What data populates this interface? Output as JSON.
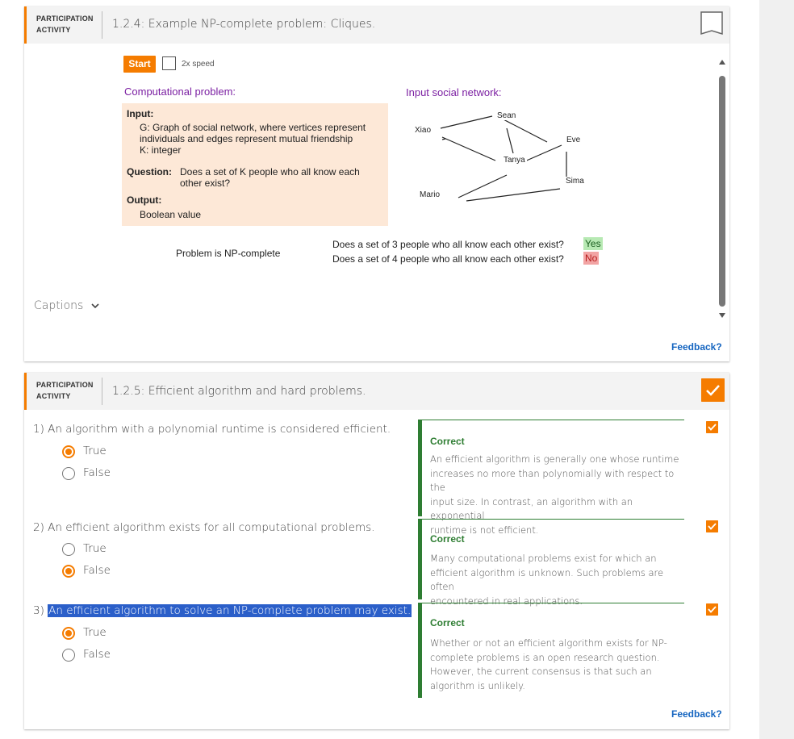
{
  "activity1": {
    "label_line1": "PARTICIPATION",
    "label_line2": "ACTIVITY",
    "title": "1.2.4: Example NP-complete problem: Cliques.",
    "start_label": "Start",
    "speed_label": "2x speed",
    "computational_problem_title": "Computational problem:",
    "input_network_title": "Input social network:",
    "problem": {
      "input_label": "Input:",
      "input_lines": [
        "G: Graph of social network, where vertices represent",
        "individuals and edges represent mutual friendship",
        "K: integer"
      ],
      "question_label": "Question:",
      "question_lines": [
        "Does a set of K people who all know each",
        "other exist?"
      ],
      "output_label": "Output:",
      "output_value": "Boolean value"
    },
    "graph": {
      "nodes": [
        "Sean",
        "Xiao",
        "Eve",
        "Tanya",
        "Sima",
        "Mario"
      ]
    },
    "np_complete_text": "Problem is NP-complete",
    "queries": [
      {
        "text": "Does a set of 3 people who all know each other exist?",
        "answer": "Yes"
      },
      {
        "text": "Does a set of 4 people who all know each other exist?",
        "answer": "No"
      }
    ],
    "captions_label": "Captions",
    "feedback_label": "Feedback?"
  },
  "activity2": {
    "label_line1": "PARTICIPATION",
    "label_line2": "ACTIVITY",
    "title": "1.2.5: Efficient algorithm and hard problems.",
    "questions": [
      {
        "number": "1)",
        "text": "An algorithm with a polynomial runtime is considered efficient.",
        "options": [
          {
            "label": "True",
            "selected": true
          },
          {
            "label": "False",
            "selected": false
          }
        ],
        "result": "Correct",
        "explanation_lines": [
          "An efficient algorithm is generally one whose runtime",
          "increases no more than polynomially with respect to the",
          "input size. In contrast, an algorithm with an exponential",
          "runtime is not efficient."
        ]
      },
      {
        "number": "2)",
        "text": "An efficient algorithm exists for all computational problems.",
        "options": [
          {
            "label": "True",
            "selected": false
          },
          {
            "label": "False",
            "selected": true
          }
        ],
        "result": "Correct",
        "explanation_lines": [
          "Many computational problems exist for which an",
          "efficient algorithm is unknown. Such problems are often",
          "encountered in real applications."
        ]
      },
      {
        "number": "3)",
        "text": "An efficient algorithm to solve an NP-complete problem may exist.",
        "options": [
          {
            "label": "True",
            "selected": true
          },
          {
            "label": "False",
            "selected": false
          }
        ],
        "result": "Correct",
        "explanation_lines": [
          "Whether or not an efficient algorithm exists for NP-",
          "complete problems is an open research question.",
          "However, the current consensus is that such an",
          "algorithm is unlikely."
        ]
      }
    ],
    "feedback_label": "Feedback?"
  },
  "colors": {
    "accent": "#f57c00",
    "correct": "#2e7d32",
    "purple": "#7b1fa2",
    "link": "#1565c0",
    "yes_bg": "#b7e9b3",
    "no_bg": "#f2a4a4",
    "highlight": "#2b5fc9"
  }
}
